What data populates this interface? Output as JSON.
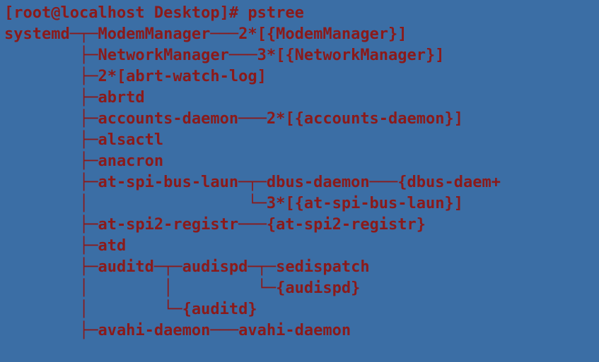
{
  "prompt": {
    "user": "root",
    "host": "localhost",
    "cwd": "Desktop",
    "symbol": "#",
    "command": "pstree",
    "full": "[root@localhost Desktop]# pstree"
  },
  "lines": {
    "l0": "[root@localhost Desktop]# pstree",
    "l1": "systemd─┬─ModemManager───2*[{ModemManager}]",
    "l2": "        ├─NetworkManager───3*[{NetworkManager}]",
    "l3": "        ├─2*[abrt-watch-log]",
    "l4": "        ├─abrtd",
    "l5": "        ├─accounts-daemon───2*[{accounts-daemon}]",
    "l6": "        ├─alsactl",
    "l7": "        ├─anacron",
    "l8": "        ├─at-spi-bus-laun─┬─dbus-daemon───{dbus-daem+",
    "l9": "        │                 └─3*[{at-spi-bus-laun}]",
    "l10": "        ├─at-spi2-registr───{at-spi2-registr}",
    "l11": "        ├─atd",
    "l12": "        ├─auditd─┬─audispd─┬─sedispatch",
    "l13": "        │        │         └─{audispd}",
    "l14": "        │        └─{auditd}",
    "l15": "        ├─avahi-daemon───avahi-daemon"
  },
  "tree": {
    "root": "systemd",
    "children": [
      {
        "name": "ModemManager",
        "threads": "2*[{ModemManager}]"
      },
      {
        "name": "NetworkManager",
        "threads": "3*[{NetworkManager}]"
      },
      {
        "name": "2*[abrt-watch-log]"
      },
      {
        "name": "abrtd"
      },
      {
        "name": "accounts-daemon",
        "threads": "2*[{accounts-daemon}]"
      },
      {
        "name": "alsactl"
      },
      {
        "name": "anacron"
      },
      {
        "name": "at-spi-bus-laun",
        "children": [
          {
            "name": "dbus-daemon",
            "threads": "{dbus-daem+"
          },
          {
            "name": "3*[{at-spi-bus-laun}]"
          }
        ]
      },
      {
        "name": "at-spi2-registr",
        "threads": "{at-spi2-registr}"
      },
      {
        "name": "atd"
      },
      {
        "name": "auditd",
        "children": [
          {
            "name": "audispd",
            "children": [
              {
                "name": "sedispatch"
              },
              {
                "name": "{audispd}"
              }
            ]
          },
          {
            "name": "{auditd}"
          }
        ]
      },
      {
        "name": "avahi-daemon",
        "children": [
          {
            "name": "avahi-daemon"
          }
        ]
      }
    ]
  }
}
